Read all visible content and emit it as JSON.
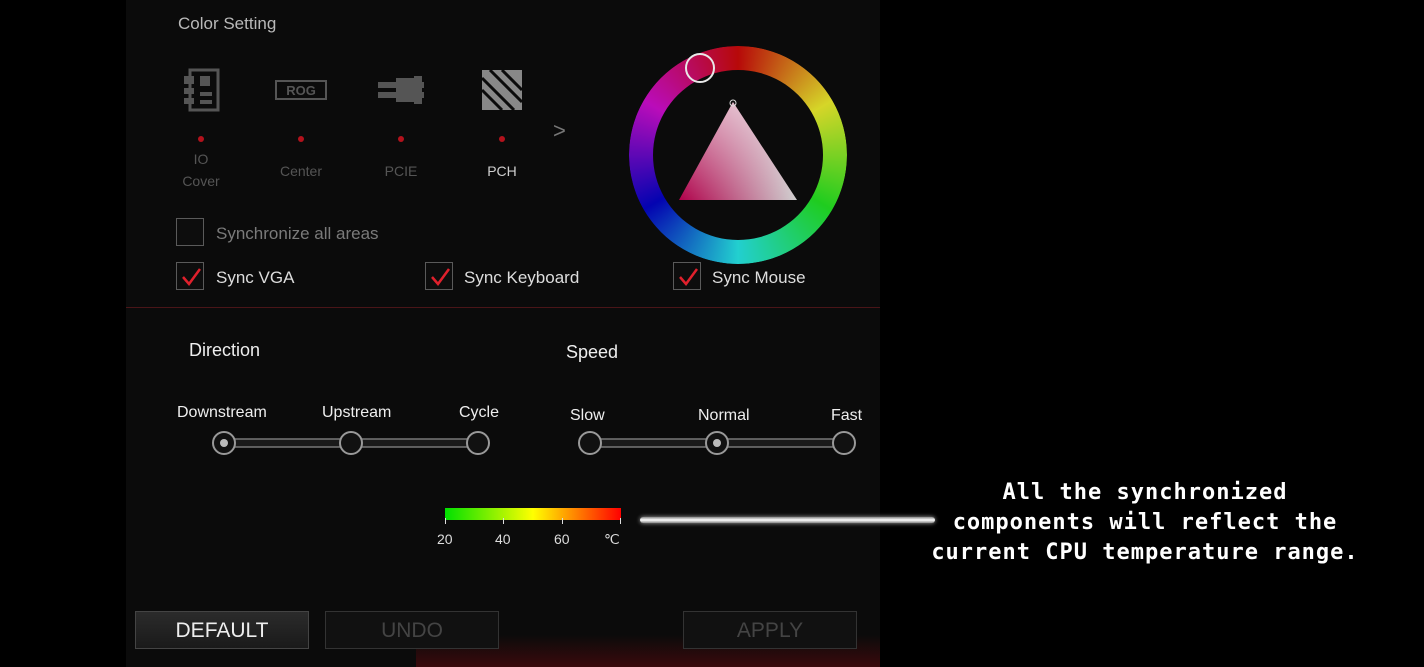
{
  "section_title": "Color Setting",
  "areas": [
    {
      "label": "IO\nCover",
      "icon": "io-cover-icon",
      "active": false
    },
    {
      "label": "Center",
      "icon": "rog-logo-icon",
      "active": false
    },
    {
      "label": "PCIE",
      "icon": "pcie-icon",
      "active": false
    },
    {
      "label": "PCH",
      "icon": "pch-icon",
      "active": true
    }
  ],
  "next_arrow": ">",
  "sync_all_label": "Synchronize all areas",
  "sync_options": [
    {
      "label": "Sync VGA",
      "checked": true
    },
    {
      "label": "Sync Keyboard",
      "checked": true
    },
    {
      "label": "Sync Mouse",
      "checked": true
    }
  ],
  "direction": {
    "title": "Direction",
    "stops": [
      "Downstream",
      "Upstream",
      "Cycle"
    ],
    "selected_index": 0
  },
  "speed": {
    "title": "Speed",
    "stops": [
      "Slow",
      "Normal",
      "Fast"
    ],
    "selected_index": 1
  },
  "temperature_legend": {
    "ticks": [
      "20",
      "40",
      "60",
      "℃"
    ],
    "colors": [
      "#00e000",
      "#ffff00",
      "#ff0000"
    ]
  },
  "buttons": {
    "default": "DEFAULT",
    "undo": "UNDO",
    "apply": "APPLY"
  },
  "callout_text": "All the synchronized\ncomponents will reflect the\ncurrent CPU temperature range.",
  "colors": {
    "accent_red": "#b3121c",
    "checkmark_red": "#e0202c",
    "background": "#0b0b0b"
  }
}
